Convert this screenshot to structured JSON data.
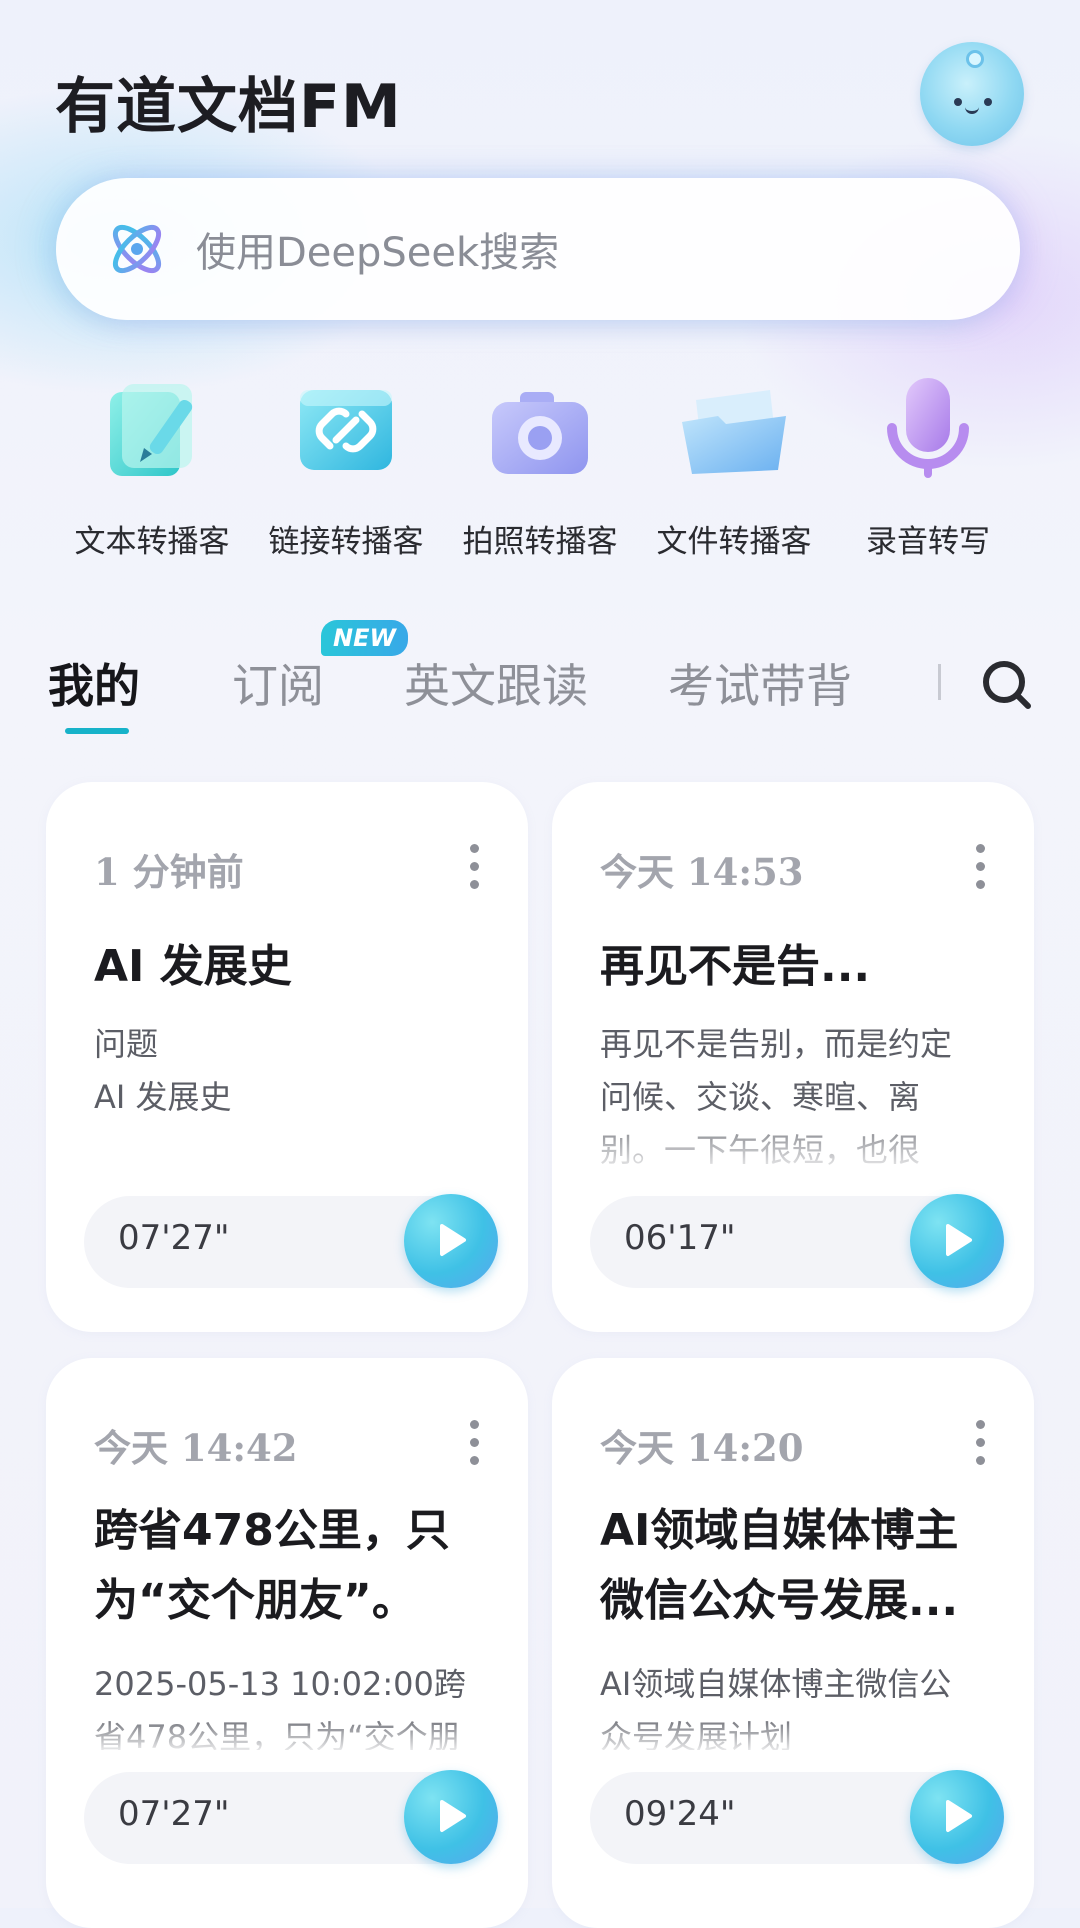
{
  "header": {
    "app_title": "有道文档FM"
  },
  "search": {
    "placeholder": "使用DeepSeek搜索",
    "icon": "deepseek-atom-icon"
  },
  "tools": [
    {
      "label": "文本转播客",
      "icon": "text-edit-icon"
    },
    {
      "label": "链接转播客",
      "icon": "link-icon"
    },
    {
      "label": "拍照转播客",
      "icon": "camera-icon"
    },
    {
      "label": "文件转播客",
      "icon": "folder-icon"
    },
    {
      "label": "录音转写",
      "icon": "microphone-icon"
    }
  ],
  "tabs": {
    "items": [
      "我的",
      "订阅",
      "英文跟读",
      "考试带背"
    ],
    "active": "我的",
    "new_badge": "NEW"
  },
  "cards": [
    {
      "time": "1 分钟前",
      "title": "AI 发展史",
      "desc_lines": [
        "问题",
        "AI 发展史"
      ],
      "duration": "07'27\""
    },
    {
      "time": "今天 14:53",
      "title": "再见不是告...",
      "desc_lines": [
        "再见不是告别，而是约定",
        "问候、交谈、寒暄、离",
        "别。一下午很短，也很"
      ],
      "duration": "06'17\""
    },
    {
      "time": "今天 14:42",
      "title": "跨省478公里，只为“交个朋友”。",
      "desc_lines": [
        "2025-05-13 10:02:00跨",
        "省478公里，只为“交个朋"
      ],
      "duration": "07'27\""
    },
    {
      "time": "今天 14:20",
      "title": "AI领域自媒体博主微信公众号发展...",
      "desc_lines": [
        "AI领域自媒体博主微信公",
        "众号发展计划"
      ],
      "duration": "09'24\""
    }
  ],
  "colors": {
    "accent": "#17b2c9",
    "play_button": "#3fc1e6"
  }
}
